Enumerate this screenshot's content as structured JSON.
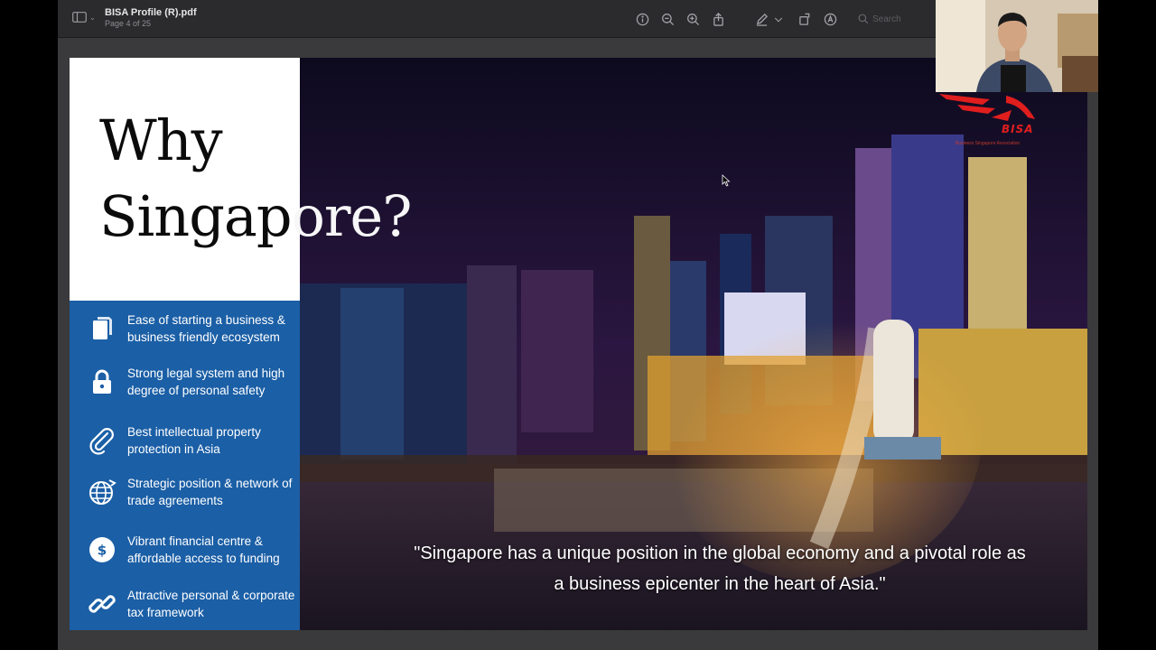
{
  "app": {
    "file_name": "BISA Profile (R).pdf",
    "page_info": "Page 4 of 25",
    "search_placeholder": "Search"
  },
  "toolbar": {
    "icons": [
      "sidebar-icon",
      "info-icon",
      "zoom-out-icon",
      "zoom-in-icon",
      "share-icon",
      "markup-icon",
      "chevron-down-icon",
      "rotate-icon",
      "annotate-icon",
      "search-icon"
    ]
  },
  "slide": {
    "heading_line1": "Why",
    "heading_line2_a": "Singap",
    "heading_line2_b": "ore?",
    "benefits": [
      {
        "icon": "document-icon",
        "text": "Ease of starting a business & business friendly ecosystem"
      },
      {
        "icon": "lock-icon",
        "text": "Strong legal system and high degree of personal safety"
      },
      {
        "icon": "paperclip-icon",
        "text": "Best intellectual property protection in Asia"
      },
      {
        "icon": "globe-icon",
        "text": "Strategic position & network of trade agreements"
      },
      {
        "icon": "dollar-icon",
        "text": "Vibrant financial centre & affordable access to funding"
      },
      {
        "icon": "link-icon",
        "text": "Attractive personal & corporate tax framework"
      }
    ],
    "quote": "\"Singapore has a unique position in the global economy and a pivotal role as a business epicenter in the heart of Asia.\"",
    "colors": {
      "blue_panel": "#1b5fa6",
      "night_sky": "#120c24"
    }
  },
  "overlay": {
    "logo_text": "BISA",
    "logo_subtext": "Business Singapore Association"
  }
}
